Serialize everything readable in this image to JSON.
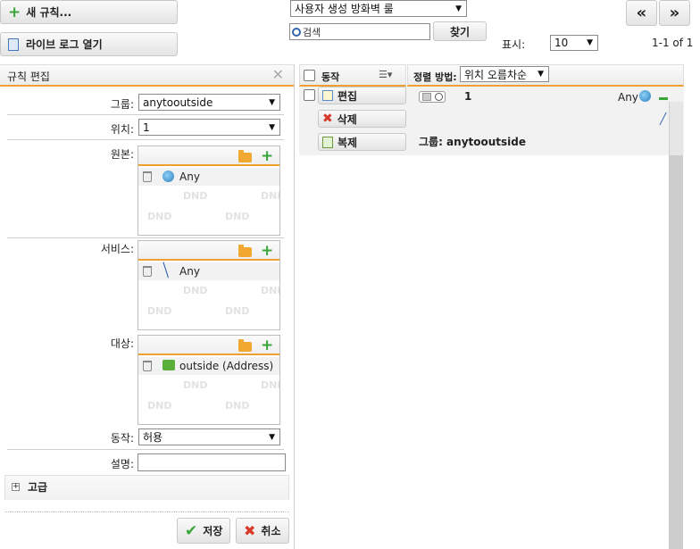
{
  "toolbar": {
    "new_rule_label": "새 규칙...",
    "live_log_label": "라이브 로그 열기",
    "filter_select_value": "사용자 생성 방화벽 룰",
    "search_placeholder": "검색",
    "search_value": "",
    "find_label": "찾기",
    "show_label": "표시:",
    "show_value": "10",
    "page_info": "1-1 of 1",
    "prev_label": "«",
    "next_label": "»"
  },
  "edit_panel": {
    "title": "규칙 편집",
    "group_label": "그룹:",
    "group_value": "anytooutside",
    "position_label": "위치:",
    "position_value": "1",
    "source_label": "원본:",
    "source_item": "Any",
    "service_label": "서비스:",
    "service_item": "Any",
    "dest_label": "대상:",
    "dest_item": "outside (Address)",
    "dnd": "DND",
    "action_label": "동작:",
    "action_value": "허용",
    "desc_label": "설명:",
    "desc_value": "",
    "advanced_label": "고급",
    "save_label": "저장",
    "cancel_label": "취소"
  },
  "list_panel": {
    "action_header": "동작",
    "sort_label": "정렬 방법:",
    "sort_value": "위치 오름차순",
    "edit_label": "편집",
    "delete_label": "삭제",
    "copy_label": "복제",
    "rule_number": "1",
    "rule_source": "Any",
    "rule_group": "그룹: anytooutside"
  },
  "colors": {
    "accent": "#f0a030",
    "green": "#3aa63a",
    "red": "#d83a2a"
  }
}
